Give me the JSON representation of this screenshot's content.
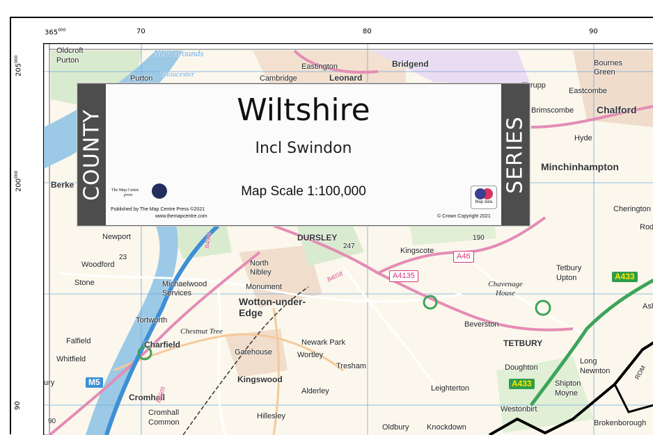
{
  "card": {
    "left_band": "COUNTY",
    "right_band": "SERIES",
    "title": "Wiltshire",
    "subtitle": "Incl Swindon",
    "scale": "Map Scale 1:100,000",
    "press_name_line1": "The Map Centre",
    "press_name_line2": "press",
    "published": "Published by The Map Centre Press ©2021",
    "website": "www.themapcentre.com",
    "os_logo_text": "OS",
    "os_caption": "Map data",
    "crown": "© Crown Copyright 2021"
  },
  "grid": {
    "eastings": [
      "365",
      "70",
      "80",
      "90"
    ],
    "easting_super": "000",
    "northings": [
      "205",
      "200",
      "90"
    ],
    "northing_super": "000"
  },
  "places": {
    "oldcroft": "Oldcroft",
    "purton_top": "Purton",
    "new_grounds": "New Grounds",
    "purton": "Purton",
    "gloucester": "Gloucester",
    "cambridge": "Cambridge",
    "eastington": "Eastington",
    "leonard": "Leonard",
    "bridgend": "Bridgend",
    "thrupp": "Thrupp",
    "bournes_green": "Bournes Green",
    "eastcombe": "Eastcombe",
    "chalford": "Chalford",
    "brimscombe": "Brimscombe",
    "hyde": "Hyde",
    "minchinhampton": "Minchinhampton",
    "berkeley": "Berke",
    "cherington": "Cherington",
    "rod": "Rod",
    "newport": "Newport",
    "dursley": "DURSLEY",
    "kingscote": "Kingscote",
    "woodford": "Woodford",
    "stone": "Stone",
    "michaelwood": "Michaelwood Services",
    "north_nibley": "North Nibley",
    "monument": "Monument",
    "wotton": "Wotton-under-Edge",
    "chavenage": "Chavenage House",
    "tetbury_upton": "Tetbury Upton",
    "tortworth": "Tortworth",
    "chestnut_tree": "Chestnut Tree",
    "beverston": "Beverston",
    "falfield": "Falfield",
    "charfield": "Charfield",
    "gatehouse": "Gatehouse",
    "newark_park": "Newark Park",
    "wortley": "Wortley",
    "tetbury": "TETBURY",
    "whitfield": "Whitfield",
    "tresham": "Tresham",
    "doughton": "Doughton",
    "long_newnton": "Long Newnton",
    "kingswood": "Kingswood",
    "leighterton": "Leighterton",
    "shipton_moyne": "Shipton Moyne",
    "cromhall": "Cromhall",
    "alderley": "Alderley",
    "westonbirt": "Westonbirt",
    "cromhall_common": "Cromhall Common",
    "hillesley": "Hillesley",
    "oldbury": "Oldbury",
    "knockdown": "Knockdown",
    "brokenborough": "Brokenborough",
    "ash": "Ash",
    "ury": "ury",
    "rom": "ROM"
  },
  "roads": {
    "a433_top": "A433",
    "a433_bottom": "A433",
    "m5": "M5",
    "a46": "A46",
    "a4135": "A4135",
    "b4058": "B4058",
    "b4509": "B4509",
    "b4060": "B4060"
  },
  "spot_heights": {
    "h247": "247",
    "h190": "190",
    "h23": "23",
    "h90": "90"
  },
  "colors": {
    "water": "#9bc9e6",
    "a_road": "#e48cb5",
    "primary_road": "#3da45a",
    "motorway": "#3d8fd6",
    "woodland": "#cfe5c2",
    "urban": "#f0d9c7",
    "card_band": "#4d4d4d"
  }
}
